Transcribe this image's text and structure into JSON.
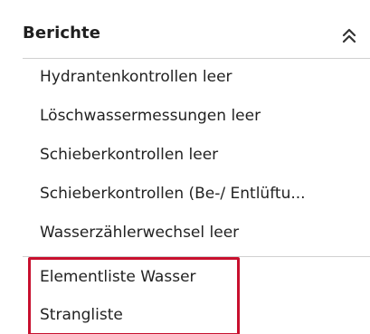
{
  "section": {
    "title": "Berichte",
    "toggle_icon": "double-chevron-up-icon"
  },
  "items": [
    {
      "label": "Hydrantenkontrollen leer"
    },
    {
      "label": "Löschwassermessungen leer"
    },
    {
      "label": "Schieberkontrollen leer"
    },
    {
      "label": "Schieberkontrollen (Be-/ Entlüftu..."
    },
    {
      "label": "Wasserzählerwechsel leer"
    },
    {
      "label": "Elementliste Wasser"
    },
    {
      "label": "Strangliste"
    }
  ],
  "colors": {
    "highlight_border": "#c8102e",
    "divider": "#d0d0d0",
    "text": "#222222"
  }
}
